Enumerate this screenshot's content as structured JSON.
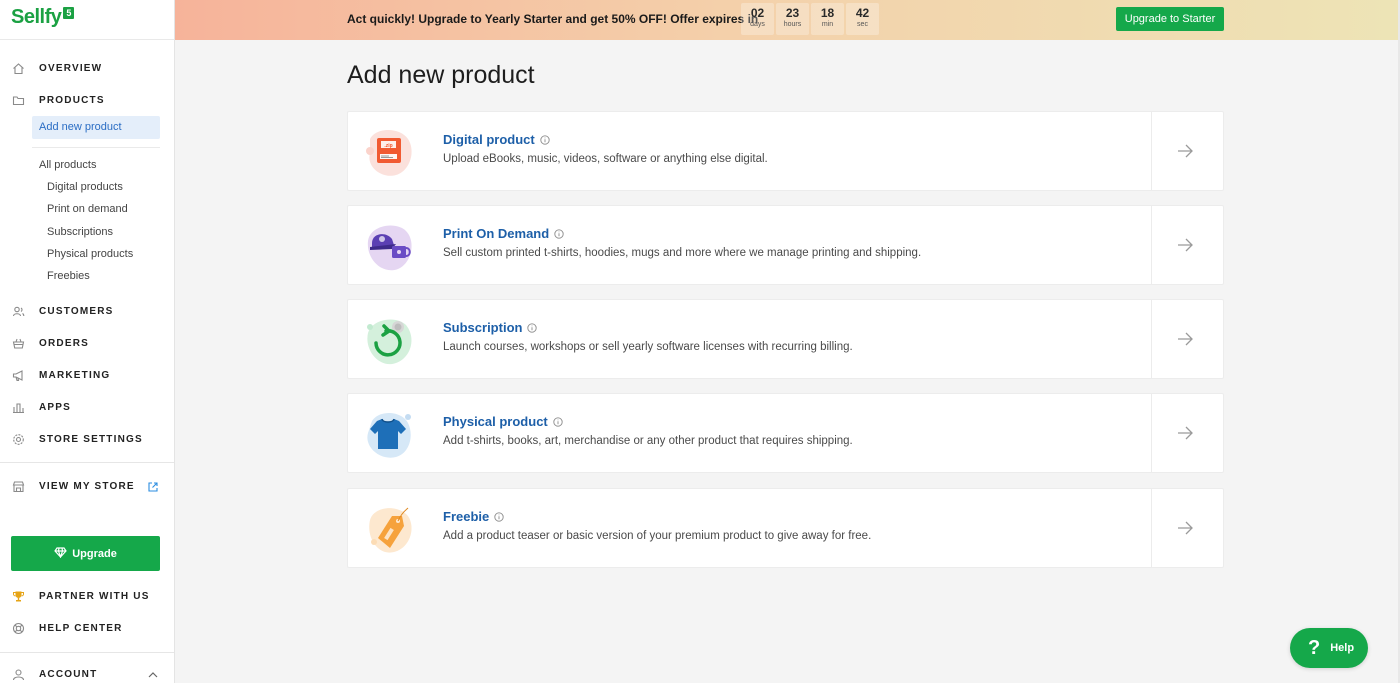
{
  "brand": {
    "name": "Sellfy",
    "badge": "5",
    "color": "#1ba143"
  },
  "banner": {
    "text": "Act quickly! Upgrade to Yearly Starter and get 50% OFF! Offer expires in",
    "countdown": [
      {
        "value": "02",
        "unit": "days"
      },
      {
        "value": "23",
        "unit": "hours"
      },
      {
        "value": "18",
        "unit": "min"
      },
      {
        "value": "42",
        "unit": "sec"
      }
    ],
    "cta_label": "Upgrade to Starter"
  },
  "sidebar": {
    "overview": "OVERVIEW",
    "products": "PRODUCTS",
    "add_new_product": "Add new product",
    "sub_items": [
      "All products",
      "Digital products",
      "Print on demand",
      "Subscriptions",
      "Physical products",
      "Freebies"
    ],
    "customers": "CUSTOMERS",
    "orders": "ORDERS",
    "marketing": "MARKETING",
    "apps": "APPS",
    "store_settings": "STORE SETTINGS",
    "view_my_store": "VIEW MY STORE",
    "upgrade_label": "Upgrade",
    "partner": "PARTNER WITH US",
    "help_center": "HELP CENTER",
    "account": "ACCOUNT"
  },
  "main": {
    "title": "Add new product",
    "cards": [
      {
        "title": "Digital product",
        "desc": "Upload eBooks, music, videos, software or anything else digital.",
        "icon": "zip-file-icon"
      },
      {
        "title": "Print On Demand",
        "desc": "Sell custom printed t-shirts, hoodies, mugs and more where we manage printing and shipping.",
        "icon": "cap-mug-icon"
      },
      {
        "title": "Subscription",
        "desc": "Launch courses, workshops or sell yearly software licenses with recurring billing.",
        "icon": "recurring-icon"
      },
      {
        "title": "Physical product",
        "desc": "Add t-shirts, books, art, merchandise or any other product that requires shipping.",
        "icon": "tshirt-icon"
      },
      {
        "title": "Freebie",
        "desc": "Add a product teaser or basic version of your premium product to give away for free.",
        "icon": "tag-icon"
      }
    ]
  },
  "help_button": {
    "symbol": "?",
    "label": "Help"
  },
  "colors": {
    "accent_green": "#15a84a",
    "link_blue": "#1d5fa8",
    "active_bg": "#e4eefa"
  }
}
